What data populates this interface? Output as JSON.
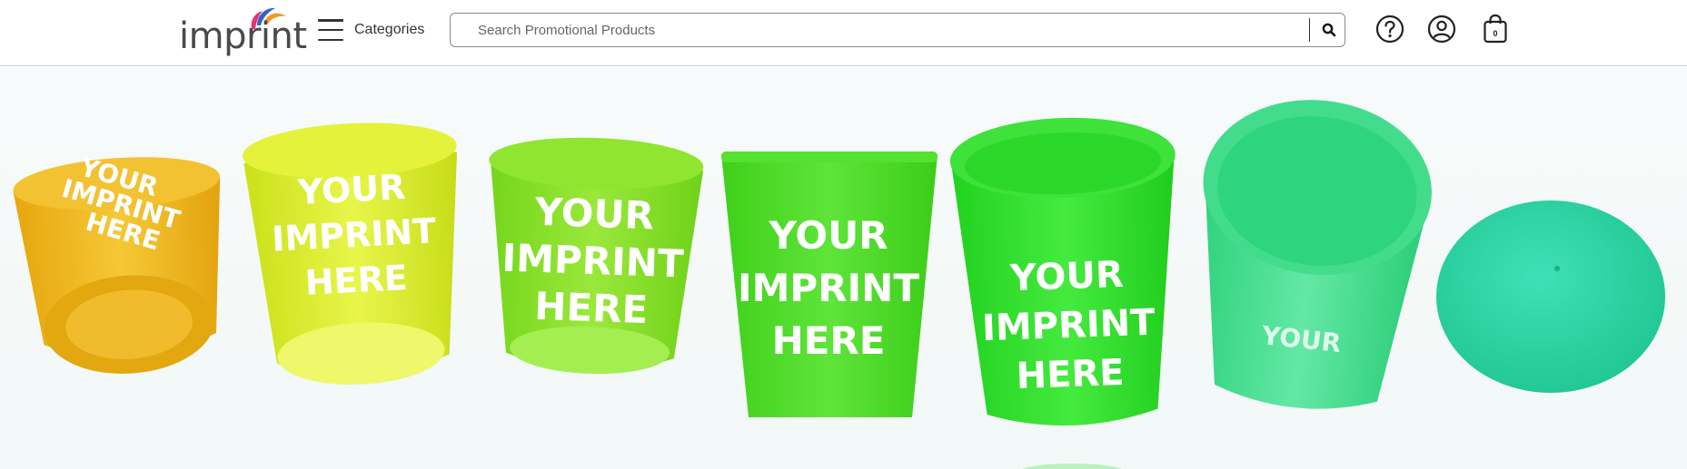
{
  "brand": {
    "logo_text": "imprint"
  },
  "nav": {
    "categories_label": "Categories"
  },
  "search": {
    "placeholder": "Search Promotional Products",
    "value": ""
  },
  "header_icons": {
    "help": "question-circle-icon",
    "account": "user-circle-icon",
    "cart": "shopping-bag-icon",
    "cart_count": "0"
  },
  "hero": {
    "cup_imprint_lines": [
      "YOUR",
      "IMPRINT",
      "HERE"
    ],
    "cup_colors": [
      "#f0b81e",
      "#d8ea2a",
      "#86e022",
      "#4fdc22",
      "#2ee02a",
      "#3ddc8a",
      "#2fd8a4"
    ]
  },
  "colors": {
    "header_border": "#cfcfcf",
    "hero_background": "#f4f9f8"
  }
}
